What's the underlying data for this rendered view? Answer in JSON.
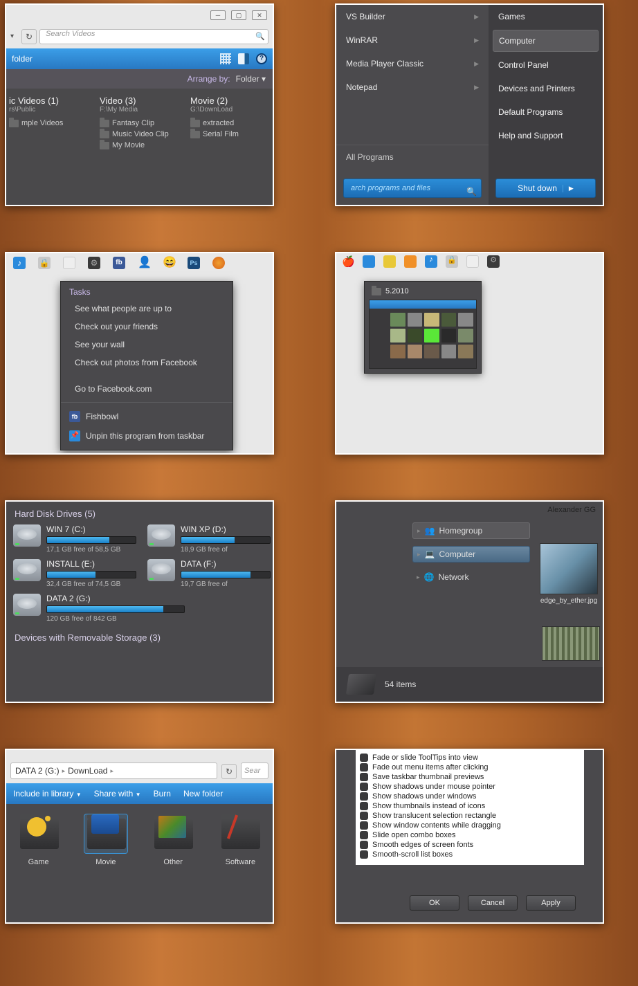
{
  "panel1": {
    "search_placeholder": "Search Videos",
    "folder_btn": "folder",
    "arrange_label": "Arrange by:",
    "arrange_value": "Folder",
    "cols": [
      {
        "title": "ic Videos (1)",
        "sub": "rs\\Public",
        "items": [
          "mple Videos"
        ]
      },
      {
        "title": "Video (3)",
        "sub": "F:\\My Media",
        "items": [
          "Fantasy Clip",
          "Music Video Clip",
          "My Movie"
        ]
      },
      {
        "title": "Movie (2)",
        "sub": "G:\\DownLoad",
        "items": [
          "extracted",
          "Serial Film"
        ]
      }
    ]
  },
  "panel2": {
    "progs": [
      "VS Builder",
      "WinRAR",
      "Media Player Classic",
      "Notepad"
    ],
    "all_programs": "All Programs",
    "search_placeholder": "arch programs and files",
    "right": [
      "Games",
      "Computer",
      "Control Panel",
      "Devices and Printers",
      "Default Programs",
      "Help and Support"
    ],
    "selected_index": 1,
    "shutdown": "Shut down"
  },
  "panel3": {
    "header": "Tasks",
    "tasks": [
      "See what people are up to",
      "Check out your friends",
      "See your wall",
      "Check out photos from Facebook"
    ],
    "go": "Go to Facebook.com",
    "app": "Fishbowl",
    "unpin": "Unpin this program from taskbar"
  },
  "panel4": {
    "title": "5.2010"
  },
  "panel5": {
    "header": "Hard Disk Drives (5)",
    "drives": [
      {
        "name": "WIN 7 (C:)",
        "free": "17,1 GB free of 58,5 GB",
        "pct": 70
      },
      {
        "name": "WIN XP (D:)",
        "free": "18,9 GB free of",
        "pct": 60
      },
      {
        "name": "INSTALL (E:)",
        "free": "32,4 GB free of 74,5 GB",
        "pct": 55
      },
      {
        "name": "DATA (F:)",
        "free": "19,7 GB free of",
        "pct": 78
      },
      {
        "name": "DATA 2 (G:)",
        "free": "120 GB free of 842 GB",
        "pct": 85
      }
    ],
    "removable": "Devices with Removable Storage (3)"
  },
  "panel6": {
    "user": "Alexander GG",
    "nodes": [
      {
        "label": "Homegroup",
        "cls": "box"
      },
      {
        "label": "Computer",
        "cls": "sel"
      },
      {
        "label": "Network",
        "cls": ""
      }
    ],
    "thumb_caption": "edge_by_ether.jpg",
    "status": "54 items"
  },
  "panel7": {
    "crumbs": [
      "DATA 2 (G:)",
      "DownLoad"
    ],
    "search_placeholder": "Sear",
    "toolbar": [
      "Include in library",
      "Share with",
      "Burn",
      "New folder"
    ],
    "folders": [
      "Game",
      "Movie",
      "Other",
      "Software"
    ],
    "selected_index": 1
  },
  "panel8": {
    "options": [
      "Fade or slide ToolTips into view",
      "Fade out menu items after clicking",
      "Save taskbar thumbnail previews",
      "Show shadows under mouse pointer",
      "Show shadows under windows",
      "Show thumbnails instead of icons",
      "Show translucent selection rectangle",
      "Show window contents while dragging",
      "Slide open combo boxes",
      "Smooth edges of screen fonts",
      "Smooth-scroll list boxes"
    ],
    "buttons": [
      "OK",
      "Cancel",
      "Apply"
    ]
  }
}
